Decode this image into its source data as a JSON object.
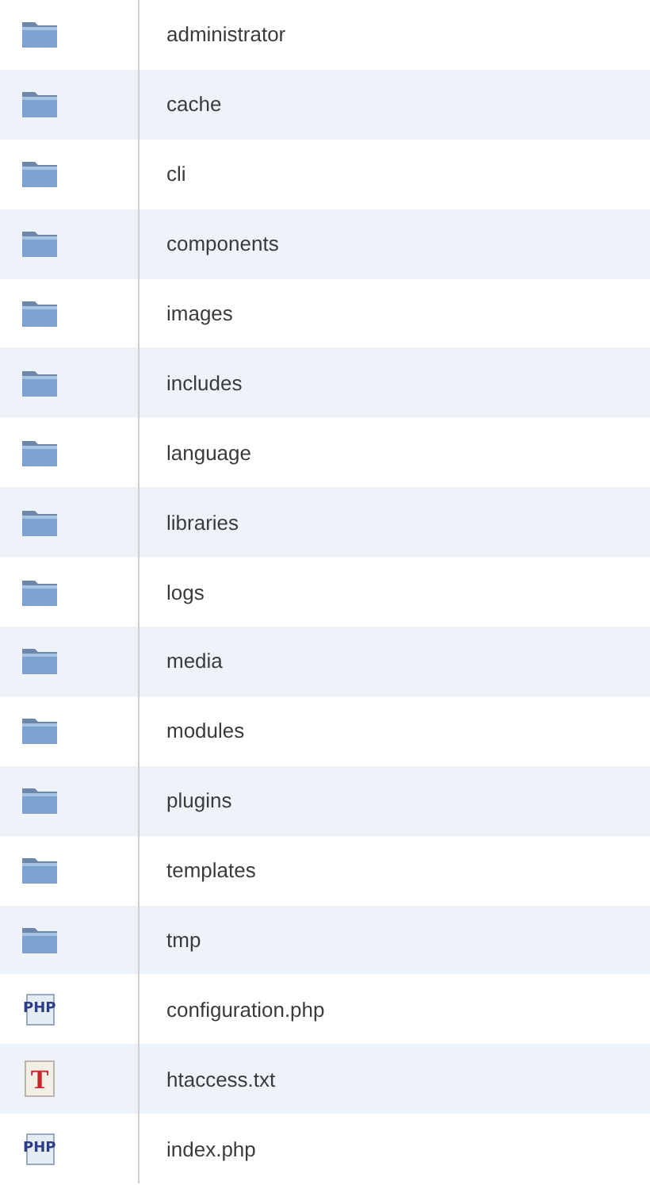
{
  "files": [
    {
      "kind": "folder",
      "name": "administrator"
    },
    {
      "kind": "folder",
      "name": "cache"
    },
    {
      "kind": "folder",
      "name": "cli"
    },
    {
      "kind": "folder",
      "name": "components"
    },
    {
      "kind": "folder",
      "name": "images"
    },
    {
      "kind": "folder",
      "name": "includes"
    },
    {
      "kind": "folder",
      "name": "language"
    },
    {
      "kind": "folder",
      "name": "libraries"
    },
    {
      "kind": "folder",
      "name": "logs"
    },
    {
      "kind": "folder",
      "name": "media"
    },
    {
      "kind": "folder",
      "name": "modules"
    },
    {
      "kind": "folder",
      "name": "plugins"
    },
    {
      "kind": "folder",
      "name": "templates"
    },
    {
      "kind": "folder",
      "name": "tmp"
    },
    {
      "kind": "php",
      "icon_text": "PHP",
      "name": "configuration.php"
    },
    {
      "kind": "text",
      "icon_text": "T",
      "name": "htaccess.txt"
    },
    {
      "kind": "php",
      "icon_text": "PHP",
      "name": "index.php"
    }
  ]
}
